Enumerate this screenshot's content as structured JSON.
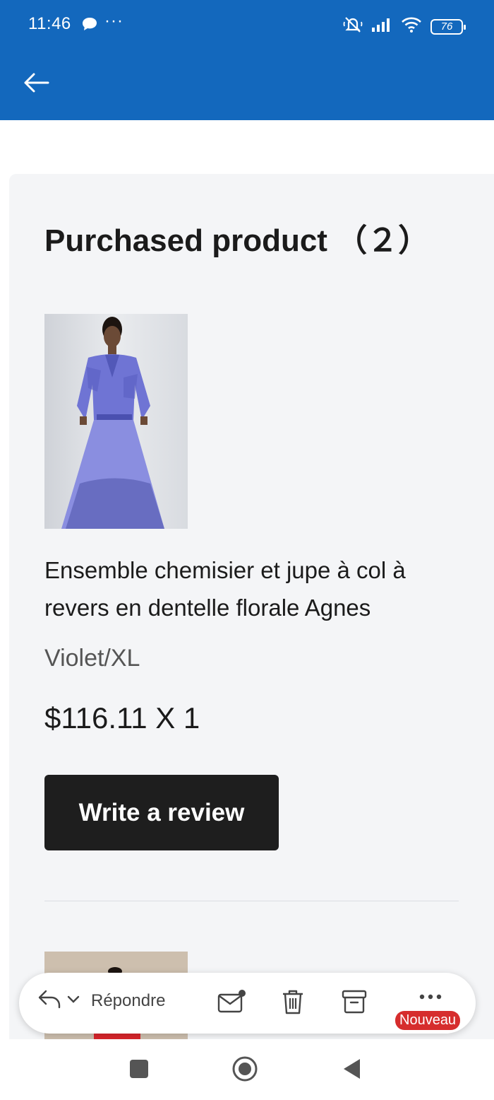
{
  "status_bar": {
    "time": "11:46",
    "more": "···",
    "battery": "76"
  },
  "section": {
    "title": "Purchased product （２）"
  },
  "products": [
    {
      "name": "Ensemble chemisier et jupe à col à revers en dentelle florale Agnes",
      "variant": "Violet/XL",
      "price": "$116.11 X 1",
      "review_label": "Write a review",
      "image_icon": "dress-photo"
    }
  ],
  "action_bar": {
    "reply_label": "Répondre",
    "badge": "Nouveau"
  },
  "colors": {
    "app_bar": "#1368bd",
    "card_bg": "#f4f5f7",
    "button": "#1e1e1e",
    "badge": "#d62d2d",
    "dress": "#7b7fd6"
  }
}
